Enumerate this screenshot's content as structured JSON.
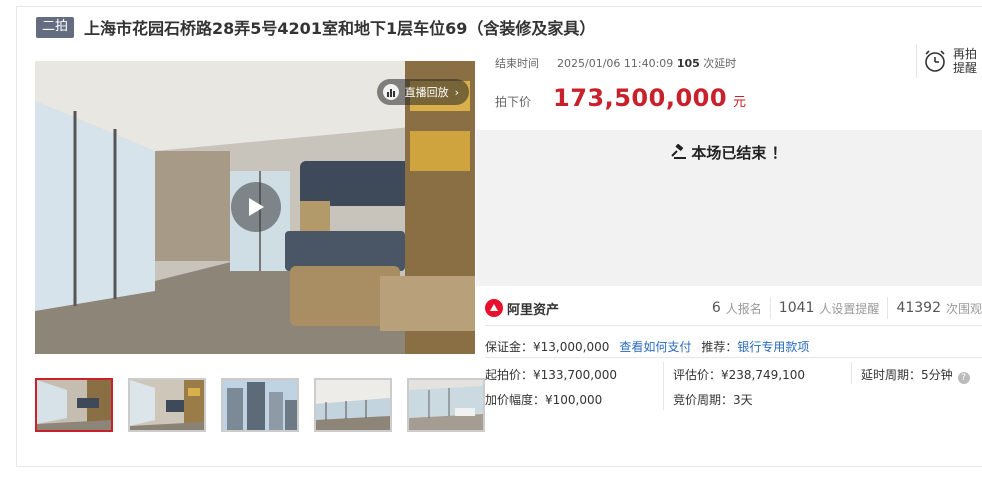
{
  "listing": {
    "round_badge": "二拍",
    "title": "上海市花园石桥路28弄5号4201室和地下1层车位69（含装修及家具）"
  },
  "media": {
    "replay_label": "直播回放",
    "thumbnail_count": 5,
    "active_thumbnail": 1
  },
  "auction": {
    "end_time_label": "结束时间",
    "end_time": "2025/01/06 11:40:09",
    "delay_count": "105",
    "delay_label": "次延时",
    "reminder_label": "再拍提醒",
    "price_label": "拍下价",
    "price": "173,500,000",
    "price_unit": "元",
    "ended_message": "本场已结束 ！"
  },
  "platform": {
    "logo_text": "阿里资产"
  },
  "stats": {
    "signups": "6",
    "signups_label": "人报名",
    "reminders": "1041",
    "reminders_label": "人设置提醒",
    "views": "41392",
    "views_label": "次围观"
  },
  "terms": {
    "deposit": "保证金：¥13,000,000",
    "how_to_pay": "查看如何支付",
    "recommend_label": "推荐：",
    "recommend_link": "银行专用款项",
    "start_price": "起拍价：¥133,700,000",
    "appraisal": "评估价：¥238,749,100",
    "delay_period": "延时周期：5分钟",
    "increment": "加价幅度：¥100,000",
    "bid_period": "竞价周期：3天"
  },
  "colors": {
    "accent_red": "#c8212b",
    "link_blue": "#2a6bbf",
    "badge_bg": "#646c82",
    "ended_bg": "#f2f2f2"
  }
}
